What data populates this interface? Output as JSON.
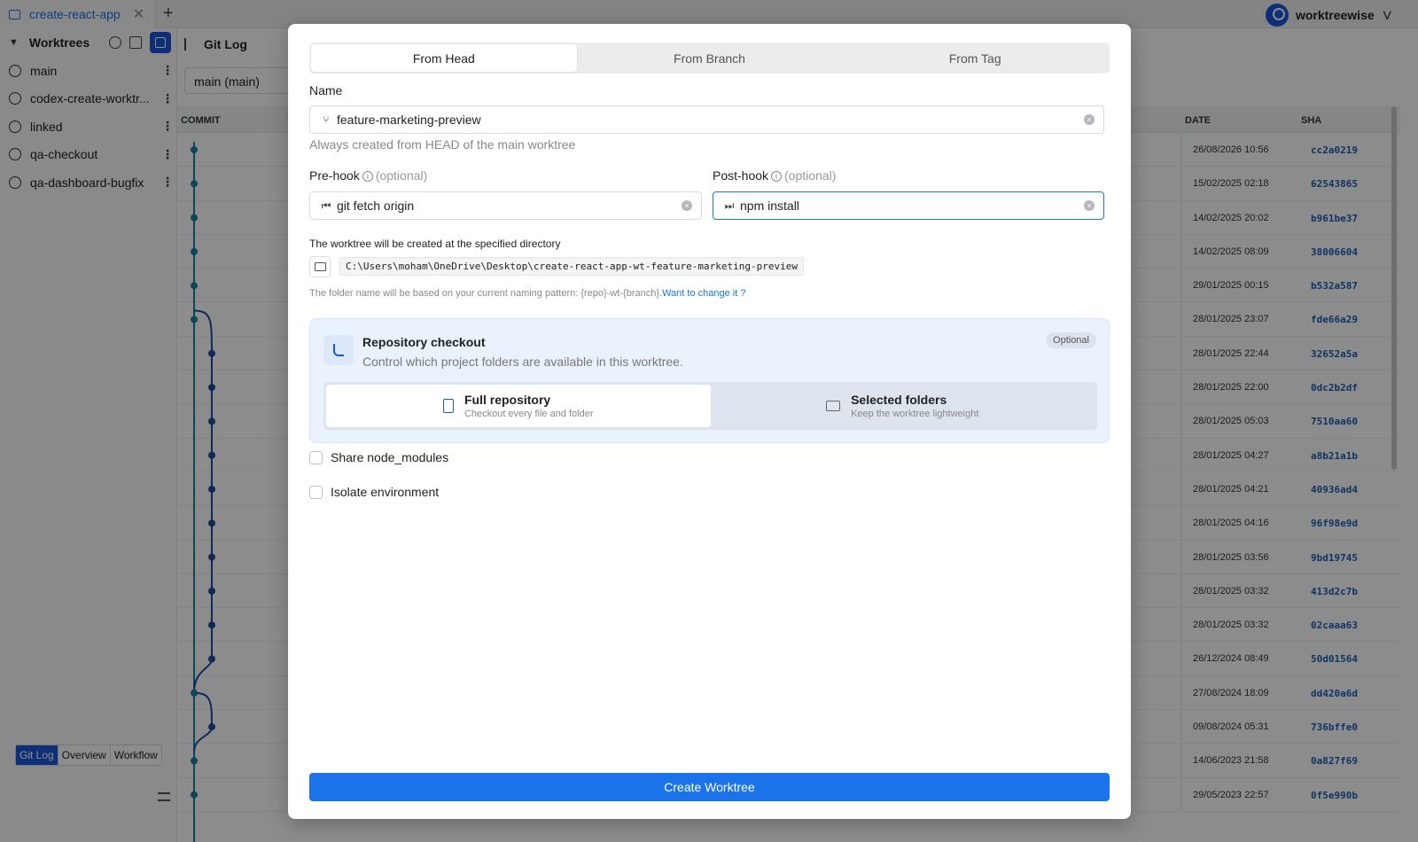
{
  "tab": {
    "title": "create-react-app",
    "close": "✕",
    "add": "+"
  },
  "user": {
    "name": "worktreewise",
    "chevron": "V"
  },
  "sidebar": {
    "title": "Worktrees",
    "items": [
      {
        "label": "main"
      },
      {
        "label": "codex-create-worktr..."
      },
      {
        "label": "linked"
      },
      {
        "label": "qa-checkout"
      },
      {
        "label": "qa-dashboard-bugfix"
      }
    ],
    "views": [
      "Git Log",
      "Overview",
      "Workflow"
    ]
  },
  "gitlog": {
    "title": "Git Log",
    "branch": "main (main)",
    "columns": {
      "commit": "COMMIT",
      "date": "DATE",
      "sha": "SHA"
    },
    "rows": [
      {
        "date": "26/08/2026 10:56",
        "sha": "cc2a0219"
      },
      {
        "date": "15/02/2025 02:18",
        "sha": "62543865"
      },
      {
        "date": "14/02/2025 20:02",
        "sha": "b961be37"
      },
      {
        "date": "14/02/2025 08:09",
        "sha": "38006604"
      },
      {
        "date": "29/01/2025 00:15",
        "sha": "b532a587"
      },
      {
        "date": "28/01/2025 23:07",
        "sha": "fde66a29"
      },
      {
        "date": "28/01/2025 22:44",
        "sha": "32652a5a"
      },
      {
        "date": "28/01/2025 22:00",
        "sha": "0dc2b2df"
      },
      {
        "date": "28/01/2025 05:03",
        "sha": "7510aa60"
      },
      {
        "date": "28/01/2025 04:27",
        "sha": "a8b21a1b"
      },
      {
        "date": "28/01/2025 04:21",
        "sha": "40936ad4"
      },
      {
        "date": "28/01/2025 04:16",
        "sha": "96f98e9d"
      },
      {
        "date": "28/01/2025 03:56",
        "sha": "9bd19745"
      },
      {
        "date": "28/01/2025 03:32",
        "sha": "413d2c7b"
      },
      {
        "date": "28/01/2025 03:32",
        "sha": "02caaa63"
      },
      {
        "date": "26/12/2024 08:49",
        "sha": "50d01564"
      },
      {
        "date": "27/08/2024 18:09",
        "sha": "dd420a6d"
      },
      {
        "date": "09/08/2024 05:31",
        "sha": "736bffe0"
      },
      {
        "date": "14/06/2023 21:58",
        "sha": "0a827f69"
      },
      {
        "date": "29/05/2023 22:57",
        "sha": "0f5e990b"
      }
    ]
  },
  "modal": {
    "tabs": [
      "From Head",
      "From Branch",
      "From Tag"
    ],
    "active_tab": "From Head",
    "name": {
      "label": "Name",
      "value": "feature-marketing-preview",
      "hint": "Always created from HEAD of the main worktree"
    },
    "prehook": {
      "label": "Pre-hook",
      "optional": "(optional)",
      "value": "git fetch origin"
    },
    "posthook": {
      "label": "Post-hook",
      "optional": "(optional)",
      "value": "npm install"
    },
    "dir_label": "The worktree will be created at the specified directory",
    "path": "C:\\Users\\moham\\OneDrive\\Desktop\\create-react-app-wt-feature-marketing-preview",
    "pattern_text": "The folder name will be based on your current naming pattern: {repo}-wt-{branch}.",
    "pattern_link": "Want to change it ?",
    "checkout": {
      "title": "Repository checkout",
      "desc": "Control which project folders are available in this worktree.",
      "badge": "Optional",
      "options": [
        {
          "title": "Full repository",
          "sub": "Checkout every file and folder"
        },
        {
          "title": "Selected folders",
          "sub": "Keep the worktree lightweight"
        }
      ]
    },
    "checkboxes": {
      "share": "Share node_modules",
      "isolate": "Isolate environment"
    },
    "submit": "Create Worktree"
  },
  "colors": {
    "accent": "#1a73e8",
    "graph_main": "#1a7fa0",
    "graph_branch": "#1a4fa0"
  }
}
